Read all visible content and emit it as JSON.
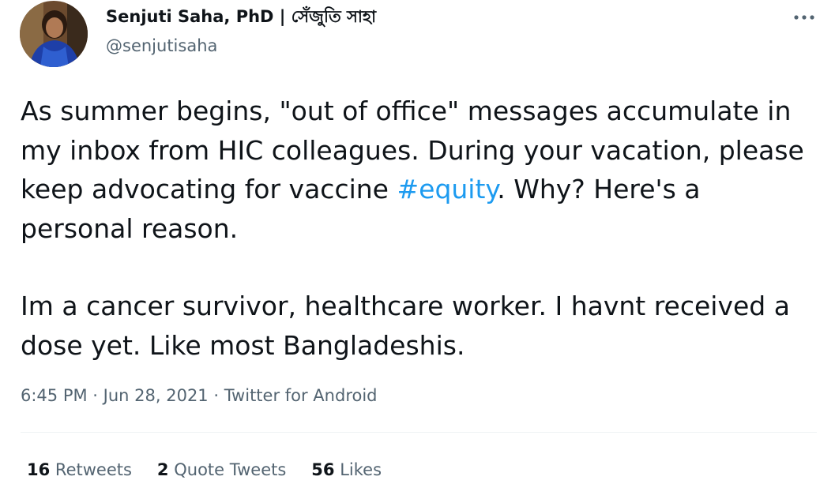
{
  "author": {
    "display_name": "Senjuti Saha, PhD | সেঁজুতি সাহা",
    "handle": "@senjutisaha"
  },
  "menu": {
    "icon": "more-horizontal-icon"
  },
  "tweet": {
    "paragraph1_before": "As summer begins, \"out of office\" messages accumulate in my inbox from HIC colleagues. During your vacation, please keep advocating for vaccine ",
    "hashtag": "#equity",
    "paragraph1_after": ". Why? Here's a personal reason.",
    "paragraph2": "Im a cancer survivor, healthcare worker. I havnt received a dose yet. Like most Bangladeshis."
  },
  "meta": {
    "time": "6:45 PM",
    "separator1": " · ",
    "date": "Jun 28, 2021",
    "separator2": " · ",
    "source": "Twitter for Android"
  },
  "stats": {
    "retweets_count": "16",
    "retweets_label": "Retweets",
    "quotes_count": "2",
    "quotes_label": "Quote Tweets",
    "likes_count": "56",
    "likes_label": "Likes"
  },
  "colors": {
    "text": "#0f1419",
    "secondary": "#536471",
    "link": "#1d9bf0",
    "divider": "#eff3f4"
  }
}
